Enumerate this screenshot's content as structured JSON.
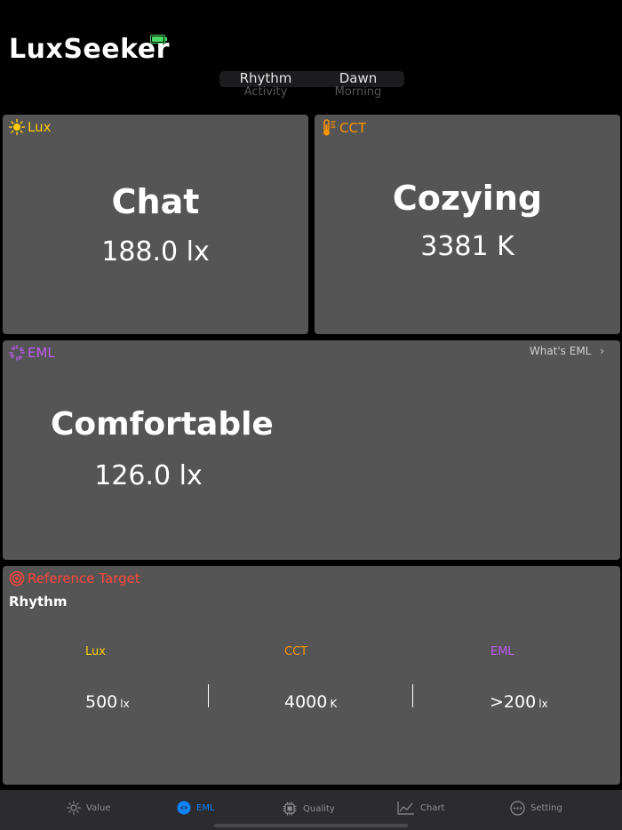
{
  "app": {
    "title": "LuxSeeker"
  },
  "segments": [
    {
      "main": "Rhythm",
      "sub": "Activity"
    },
    {
      "main": "Dawn",
      "sub": "Morning"
    }
  ],
  "lux_card": {
    "title": "Lux",
    "label": "Chat",
    "value": "188.0 lx",
    "accent": "#ffcc00"
  },
  "cct_card": {
    "title": "CCT",
    "label": "Cozying",
    "value": "3381 K",
    "accent": "#ff9500"
  },
  "eml_card": {
    "title": "EML",
    "label": "Comfortable",
    "value": "126.0 lx",
    "link": "What's EML",
    "accent": "#bf5af2"
  },
  "reference": {
    "title": "Reference Target",
    "subtitle": "Rhythm",
    "accent": "#ff453a",
    "items": [
      {
        "label": "Lux",
        "value": "500",
        "unit": "lx",
        "color": "#ffcc00"
      },
      {
        "label": "CCT",
        "value": "4000",
        "unit": "K",
        "color": "#ff9500"
      },
      {
        "label": "EML",
        "value": ">200",
        "unit": "lx",
        "color": "#bf5af2"
      }
    ]
  },
  "tabs": [
    {
      "label": "Value",
      "icon": "sun-icon"
    },
    {
      "label": "EML",
      "icon": "eye-icon",
      "active": true
    },
    {
      "label": "Quality",
      "icon": "chip-icon"
    },
    {
      "label": "Chart",
      "icon": "chart-icon"
    },
    {
      "label": "Setting",
      "icon": "ellipsis-circle-icon"
    }
  ]
}
